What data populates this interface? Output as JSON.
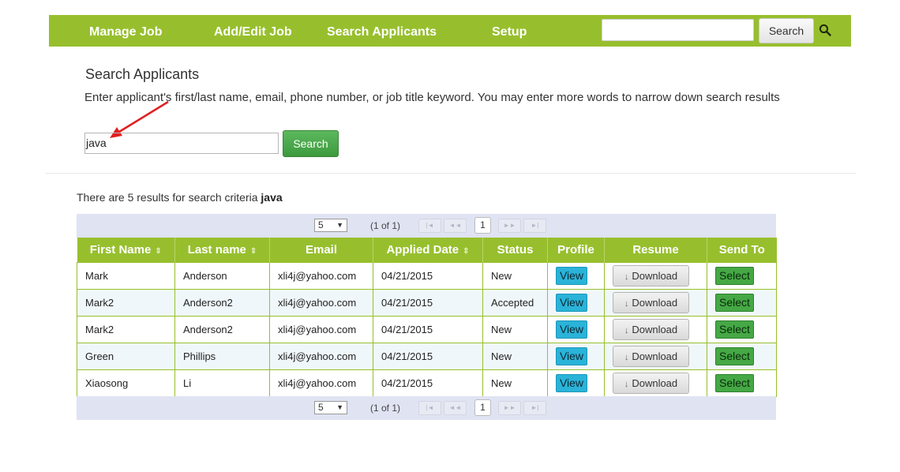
{
  "nav": {
    "items": [
      "Manage Job",
      "Add/Edit Job",
      "Search Applicants",
      "Setup"
    ],
    "search_value": "",
    "search_button": "Search",
    "color": "#97bf2d"
  },
  "search": {
    "title": "Search Applicants",
    "instructions": "Enter applicant's first/last name, email, phone number, or job title keyword. You may enter more words to narrow down search results",
    "query": "java",
    "button": "Search"
  },
  "results": {
    "summary_prefix": "There are 5 results for search criteria ",
    "criteria": "java"
  },
  "paginator": {
    "page_size": "5",
    "info": "(1 of 1)",
    "current_page": "1"
  },
  "table": {
    "headers": [
      "First Name",
      "Last name",
      "Email",
      "Applied Date",
      "Status",
      "Profile",
      "Resume",
      "Send To"
    ],
    "view_label": "View",
    "download_label": "Download",
    "select_label": "Select",
    "rows": [
      {
        "first": "Mark",
        "last": "Anderson",
        "email": "xli4j@yahoo.com",
        "date": "04/21/2015",
        "status": "New"
      },
      {
        "first": "Mark2",
        "last": "Anderson2",
        "email": "xli4j@yahoo.com",
        "date": "04/21/2015",
        "status": "Accepted"
      },
      {
        "first": "Mark2",
        "last": "Anderson2",
        "email": "xli4j@yahoo.com",
        "date": "04/21/2015",
        "status": "New"
      },
      {
        "first": "Green",
        "last": "Phillips",
        "email": "xli4j@yahoo.com",
        "date": "04/21/2015",
        "status": "New"
      },
      {
        "first": "Xiaosong",
        "last": "Li",
        "email": "xli4j@yahoo.com",
        "date": "04/21/2015",
        "status": "New"
      }
    ]
  }
}
